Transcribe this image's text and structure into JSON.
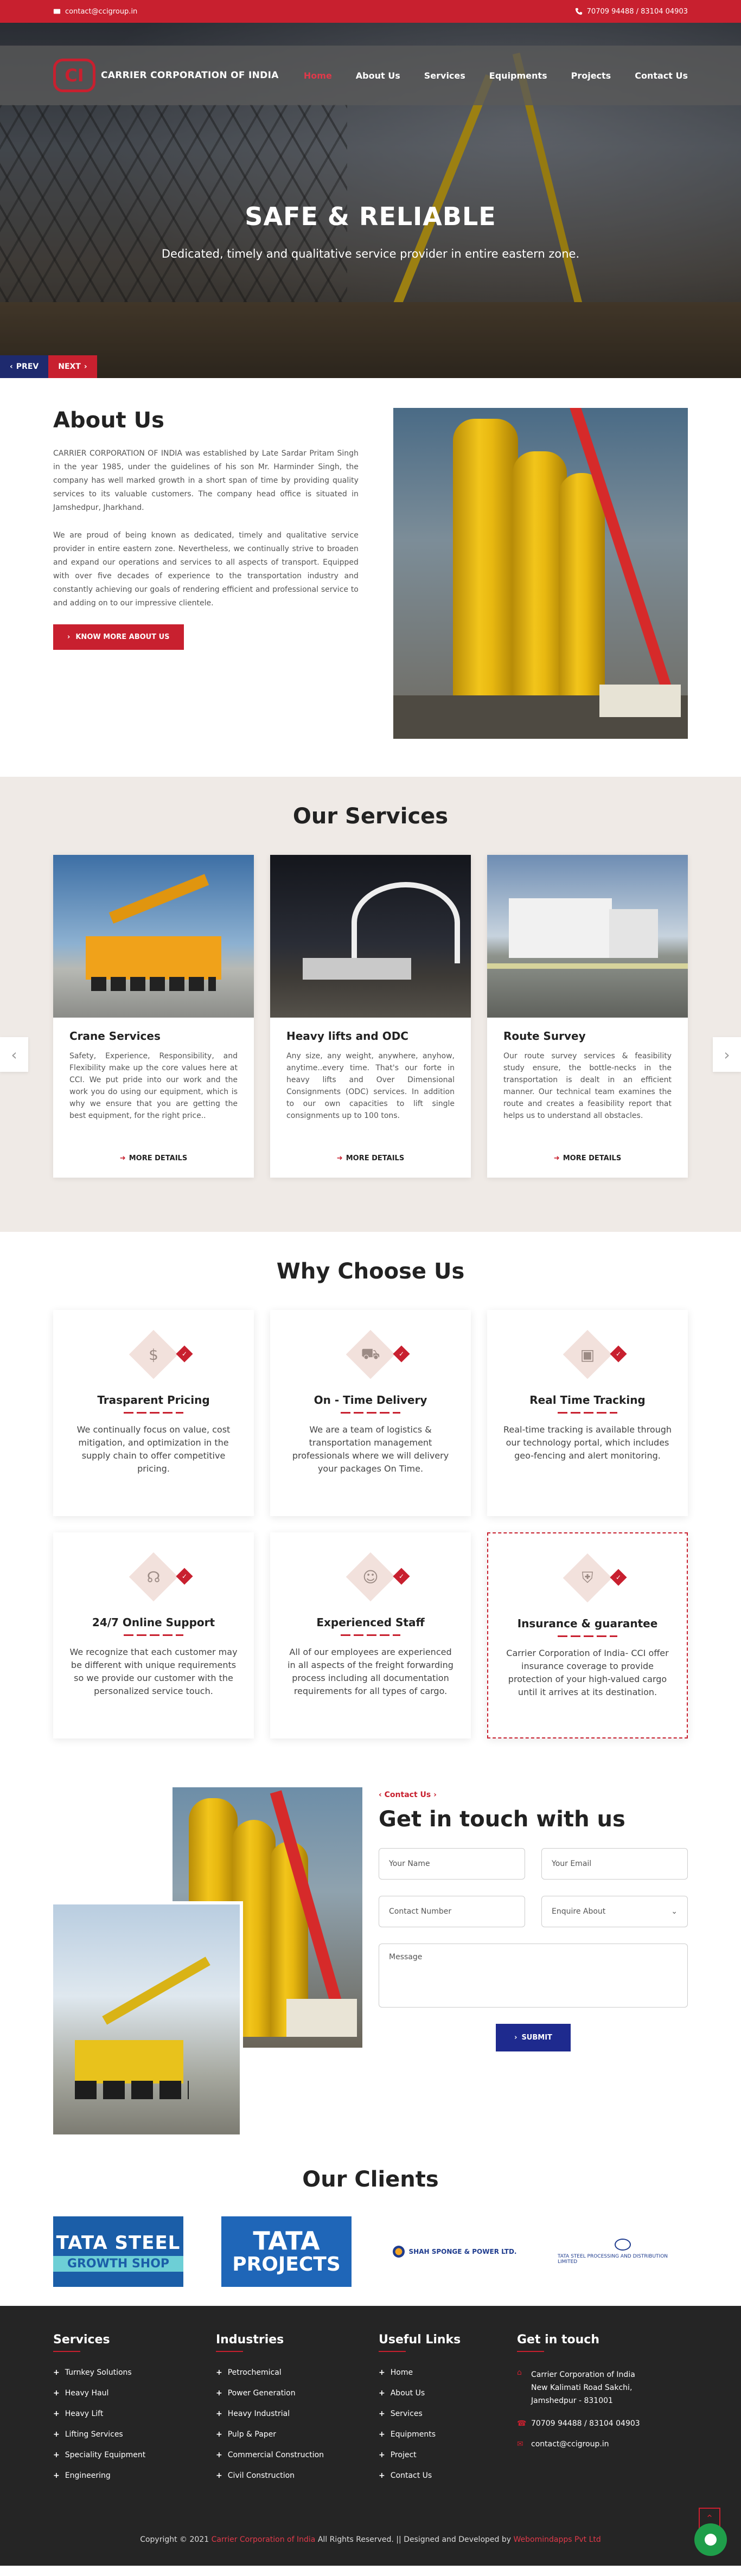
{
  "topbar": {
    "email": "contact@ccigroup.in",
    "phone": "70709 94488 / 83104 04903"
  },
  "brand": {
    "logo_text": "CI",
    "name": "CARRIER CORPORATION OF INDIA"
  },
  "nav": [
    "Home",
    "About Us",
    "Services",
    "Equipments",
    "Projects",
    "Contact Us"
  ],
  "hero": {
    "title": "SAFE & RELIABLE",
    "subtitle": "Dedicated, timely and qualitative service provider in entire eastern zone.",
    "prev": "PREV",
    "next": "NEXT"
  },
  "about": {
    "title": "About Us",
    "p1": "CARRIER CORPORATION OF INDIA was established by Late Sardar Pritam Singh in the year 1985, under the guidelines of his son Mr. Harminder Singh, the company has well marked growth in a short span of time by providing quality services to its valuable customers. The company head office is situated in Jamshedpur, Jharkhand.",
    "p2": "We are proud of being known as dedicated, timely and qualitative service provider in entire eastern zone. Nevertheless, we continually strive to broaden and expand our operations and services to all aspects of transport. Equipped with over five decades of experience to the transportation industry and constantly achieving our goals of rendering efficient and professional service to and adding on to our impressive clientele.",
    "button": "KNOW MORE ABOUT US"
  },
  "services": {
    "title": "Our Services",
    "more": "MORE DETAILS",
    "items": [
      {
        "title": "Crane Services",
        "text": "Safety, Experience, Responsibility, and Flexibility make up the core values here at CCI. We put pride into our work and the work you do using our equipment, which is why we ensure that you are getting the best equipment, for the right price.."
      },
      {
        "title": "Heavy lifts and ODC",
        "text": "Any size, any weight, anywhere, anyhow, anytime..every time. That's our forte in heavy lifts and Over Dimensional Consignments (ODC) services. In addition to our own capacities to lift single consignments up to 100 tons."
      },
      {
        "title": "Route Survey",
        "text": "Our route survey services & feasibility study ensure, the bottle-necks in the transportation is dealt in an efficient manner. Our technical team examines the route and creates a feasibility report that helps us to understand all obstacles."
      }
    ]
  },
  "why": {
    "title": "Why Choose Us",
    "items": [
      {
        "title": "Trasparent Pricing",
        "text": "We continually focus on value, cost mitigation, and optimization in the supply chain to offer competitive pricing.",
        "icon": "price-tag-icon"
      },
      {
        "title": "On - Time Delivery",
        "text": "We are a team of logistics & transportation management professionals where we will delivery your packages On Time.",
        "icon": "delivery-truck-icon"
      },
      {
        "title": "Real Time Tracking",
        "text": "Real-time tracking is available through our technology portal, which includes geo-fencing and alert monitoring.",
        "icon": "tracking-box-icon"
      },
      {
        "title": "24/7 Online Support",
        "text": "We recognize that each customer may be different with unique requirements so we provide our customer with the personalized service touch.",
        "icon": "headset-icon"
      },
      {
        "title": "Experienced Staff",
        "text": "All of our employees are experienced in all aspects of the freight forwarding process including all documentation requirements for all types of cargo.",
        "icon": "staff-icon"
      },
      {
        "title": "Insurance & guarantee",
        "text": "Carrier Corporation of India- CCI offer insurance coverage to provide protection of your high-valued cargo until it arrives at its destination.",
        "icon": "insurance-icon"
      }
    ]
  },
  "contact": {
    "eyebrow": "Contact Us",
    "title": "Get in touch with us",
    "name_placeholder": "Your Name",
    "email_placeholder": "Your Email",
    "phone_placeholder": "Contact Number",
    "enquiry_placeholder": "Enquire About",
    "message_placeholder": "Message",
    "submit": "SUBMIT"
  },
  "clients": {
    "title": "Our Clients",
    "tata_steel": {
      "line1": "TATA STEEL",
      "line2": "GROWTH SHOP"
    },
    "tata_projects": {
      "line1": "TATA",
      "line2": "PROJECTS"
    },
    "shah": "SHAH SPONGE & POWER LTD.",
    "tata_power": "TATA STEEL PROCESSING AND DISTRIBUTION LIMITED"
  },
  "footer": {
    "services_title": "Services",
    "services": [
      "Turnkey Solutions",
      "Heavy Haul",
      "Heavy Lift",
      "Lifting Services",
      "Speciality Equipment",
      "Engineering"
    ],
    "industries_title": "Industries",
    "industries": [
      "Petrochemical",
      "Power Generation",
      "Heavy Industrial",
      "Pulp & Paper",
      "Commercial Construction",
      "Civil Construction"
    ],
    "links_title": "Useful Links",
    "links": [
      "Home",
      "About Us",
      "Services",
      "Equipments",
      "Project",
      "Contact Us"
    ],
    "touch_title": "Get in touch",
    "address": [
      "Carrier Corporation of India",
      "New Kalimati Road Sakchi,",
      "Jamshedpur - 831001"
    ],
    "phone": "70709 94488 / 83104 04903",
    "email": "contact@ccigroup.in",
    "copy_prefix": "Copyright © 2021",
    "copy_company": "Carrier Corporation of India",
    "copy_middle": "All Rights Reserved. || Designed and Developed by",
    "copy_dev": "Webomindapps Pvt Ltd"
  }
}
